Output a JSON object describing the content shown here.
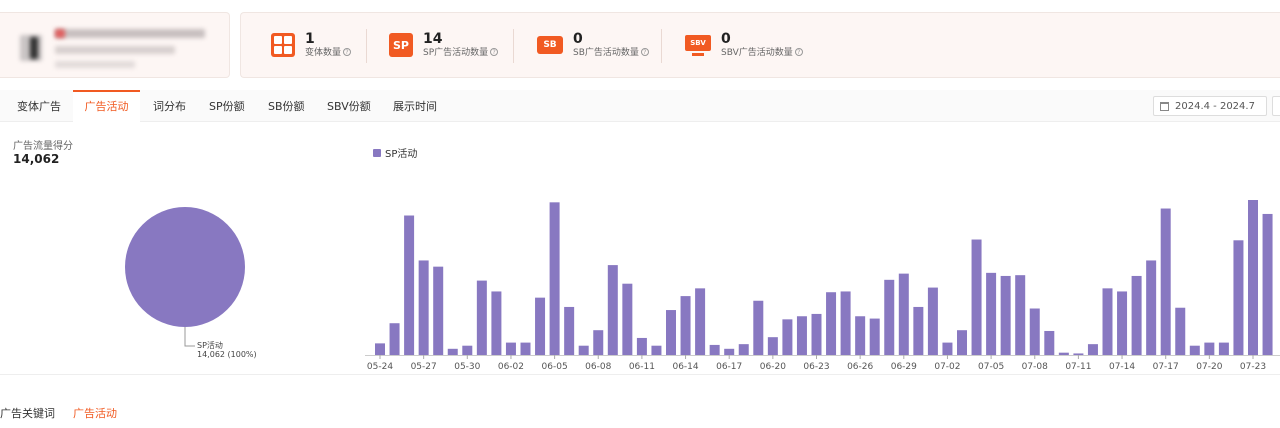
{
  "stats": [
    {
      "icon": "grid-icon",
      "icon_text": "",
      "value": "1",
      "label": "变体数量"
    },
    {
      "icon": "sp-icon",
      "icon_text": "SP",
      "value": "14",
      "label": "SP广告活动数量"
    },
    {
      "icon": "sb-icon",
      "icon_text": "SB",
      "value": "0",
      "label": "SB广告活动数量"
    },
    {
      "icon": "sbv-icon",
      "icon_text": "SBV",
      "value": "0",
      "label": "SBV广告活动数量"
    }
  ],
  "help_glyph": "?",
  "tabs": [
    {
      "label": "变体广告",
      "active": false
    },
    {
      "label": "广告活动",
      "active": true
    },
    {
      "label": "词分布",
      "active": false
    },
    {
      "label": "SP份额",
      "active": false
    },
    {
      "label": "SB份额",
      "active": false
    },
    {
      "label": "SBV份额",
      "active": false
    },
    {
      "label": "展示时间",
      "active": false
    }
  ],
  "date_range": "2024.4 - 2024.7",
  "score": {
    "label": "广告流量得分",
    "value": "14,062"
  },
  "pie": {
    "label": "SP活动",
    "value_text": "14,062 (100%)",
    "color": "#8878c1"
  },
  "bottom_tabs": [
    {
      "label": "广告关键词",
      "active": false
    },
    {
      "label": "广告活动",
      "active": true
    }
  ],
  "colors": {
    "accent": "#f15a22",
    "series": "#8878c1"
  },
  "chart_data": {
    "type": "bar",
    "legend_position": "top-left",
    "grid": false,
    "ylim": [
      0,
      1000
    ],
    "series": [
      {
        "name": "SP活动",
        "color": "#8878c1"
      }
    ],
    "x_tick_labels": [
      "05-24",
      "05-27",
      "05-30",
      "06-02",
      "06-05",
      "06-08",
      "06-11",
      "06-14",
      "06-17",
      "06-20",
      "06-23",
      "06-26",
      "06-29",
      "07-02",
      "07-05",
      "07-08",
      "07-11",
      "07-14",
      "07-17",
      "07-20",
      "07-23"
    ],
    "values": [
      75,
      205,
      900,
      610,
      570,
      40,
      60,
      480,
      410,
      80,
      80,
      370,
      985,
      310,
      60,
      160,
      580,
      460,
      110,
      60,
      290,
      380,
      430,
      65,
      40,
      70,
      350,
      115,
      230,
      250,
      265,
      405,
      410,
      250,
      235,
      485,
      525,
      310,
      435,
      80,
      160,
      745,
      530,
      510,
      515,
      300,
      155,
      15,
      10,
      70,
      430,
      410,
      510,
      610,
      945,
      305,
      60,
      80,
      80,
      740,
      1070,
      910
    ]
  }
}
